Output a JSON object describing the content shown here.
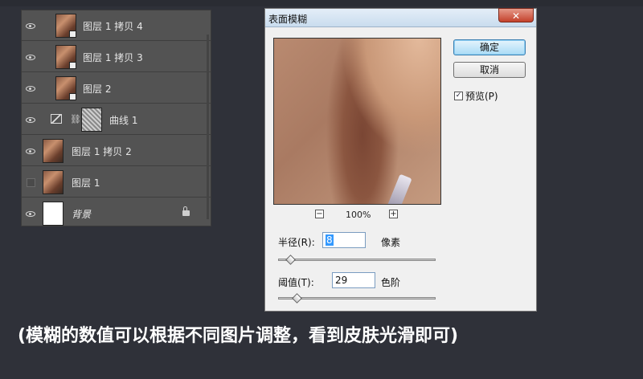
{
  "layers_panel": {
    "layers": [
      {
        "name": "图层 1 拷贝 4",
        "visible": true
      },
      {
        "name": "图层 1 拷贝 3",
        "visible": true
      },
      {
        "name": "图层 2",
        "visible": true
      },
      {
        "name": "曲线 1",
        "visible": true
      },
      {
        "name": "图层 1 拷贝 2",
        "visible": true
      },
      {
        "name": "图层 1",
        "visible": false
      },
      {
        "name": "背景",
        "visible": true
      }
    ],
    "icons": [
      "eye-icon",
      "curves-adjustment-icon",
      "link-chain-icon",
      "lock-icon"
    ]
  },
  "dialog": {
    "title": "表面模糊",
    "close_label": "✕",
    "ok_label": "确定",
    "cancel_label": "取消",
    "preview_label": "预览(P)",
    "preview_checked": true,
    "zoom_out": "−",
    "zoom_in": "+",
    "zoom_level": "100%",
    "radius": {
      "label": "半径(R):",
      "value": "8",
      "unit": "像素",
      "slider_fraction": 0.07
    },
    "threshold": {
      "label": "阈值(T):",
      "value": "29",
      "unit": "色阶",
      "slider_fraction": 0.11
    }
  },
  "caption": "(模糊的数值可以根据不同图片调整，看到皮肤光滑即可)",
  "colors": {
    "background": "#2f3139",
    "panel": "#535353",
    "dialog": "#f0f0f0",
    "accent": "#3399ff"
  }
}
